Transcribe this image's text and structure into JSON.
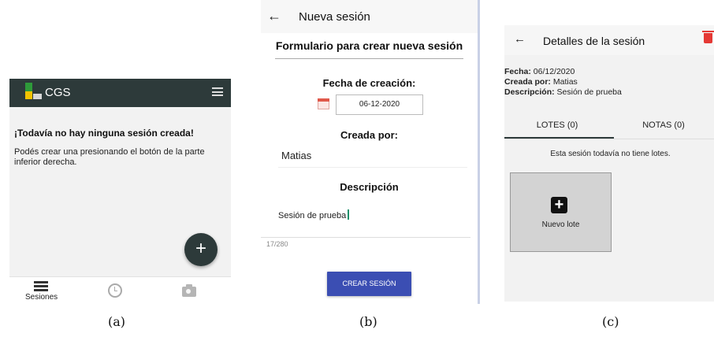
{
  "screen_a": {
    "app_title": "CGS",
    "empty_title": "¡Todavía no hay ninguna sesión creada!",
    "empty_body": "Podés crear una presionando el botón de la parte inferior derecha.",
    "fab_label": "+",
    "nav": {
      "sessions_label": "Sesiones",
      "icons": [
        "list-icon",
        "history-icon",
        "camera-icon"
      ]
    }
  },
  "screen_b": {
    "back_glyph": "←",
    "title": "Nueva sesión",
    "form_title": "Formulario para crear nueva sesión",
    "date_label": "Fecha de creación:",
    "date_value": "06-12-2020",
    "creator_label": "Creada por:",
    "creator_value": "Matias",
    "description_label": "Descripción",
    "description_value": "Sesión de prueba",
    "char_counter": "17/280",
    "submit_label": "CREAR SESIÓN"
  },
  "screen_c": {
    "back_glyph": "←",
    "title": "Detalles de la sesión",
    "date_label": "Fecha:",
    "date_value": "06/12/2020",
    "creator_label": "Creada por:",
    "creator_value": "Matias",
    "description_label": "Descripción:",
    "description_value": "Sesión de prueba",
    "tabs": [
      {
        "label": "LOTES (0)",
        "active": true
      },
      {
        "label": "NOTAS (0)",
        "active": false
      }
    ],
    "empty_message": "Esta sesión todavía no tiene lotes.",
    "new_lot_label": "Nuevo lote",
    "plus_glyph": "+"
  },
  "captions": [
    "(a)",
    "(b)",
    "(c)"
  ],
  "colors": {
    "appbar_dark": "#2d3a3a",
    "primary_button": "#3b4eb3",
    "delete_red": "#e53935",
    "logo_green": "#2e9a3a",
    "logo_yellow": "#f2c200"
  }
}
